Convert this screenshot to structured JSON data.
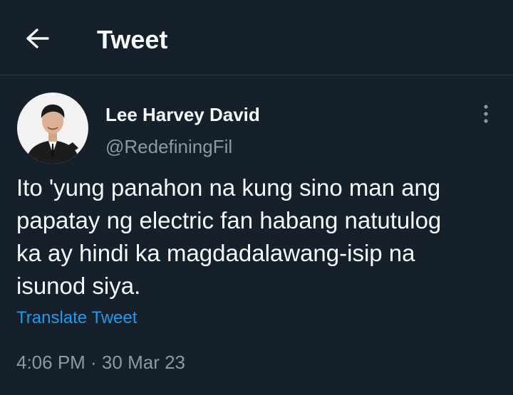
{
  "header": {
    "back_icon": "arrow-left-icon",
    "title": "Tweet"
  },
  "tweet": {
    "author": {
      "name": "Lee Harvey David",
      "handle": "@RedefiningFil",
      "avatar_icon": "profile-photo"
    },
    "more_icon": "vertical-dots-icon",
    "text": "Ito 'yung panahon na kung sino man ang\npapatay ng electric fan habang natutulog\nka ay hindi ka magdadalawang-isip na\nisunod siya.",
    "translate_label": "Translate Tweet",
    "timestamp": "4:06 PM · 30 Mar 23"
  },
  "colors": {
    "background": "#15202b",
    "text_primary": "#f7f9f9",
    "text_secondary": "#8b98a5",
    "link": "#1d9bf0",
    "divider": "#2b3640"
  }
}
